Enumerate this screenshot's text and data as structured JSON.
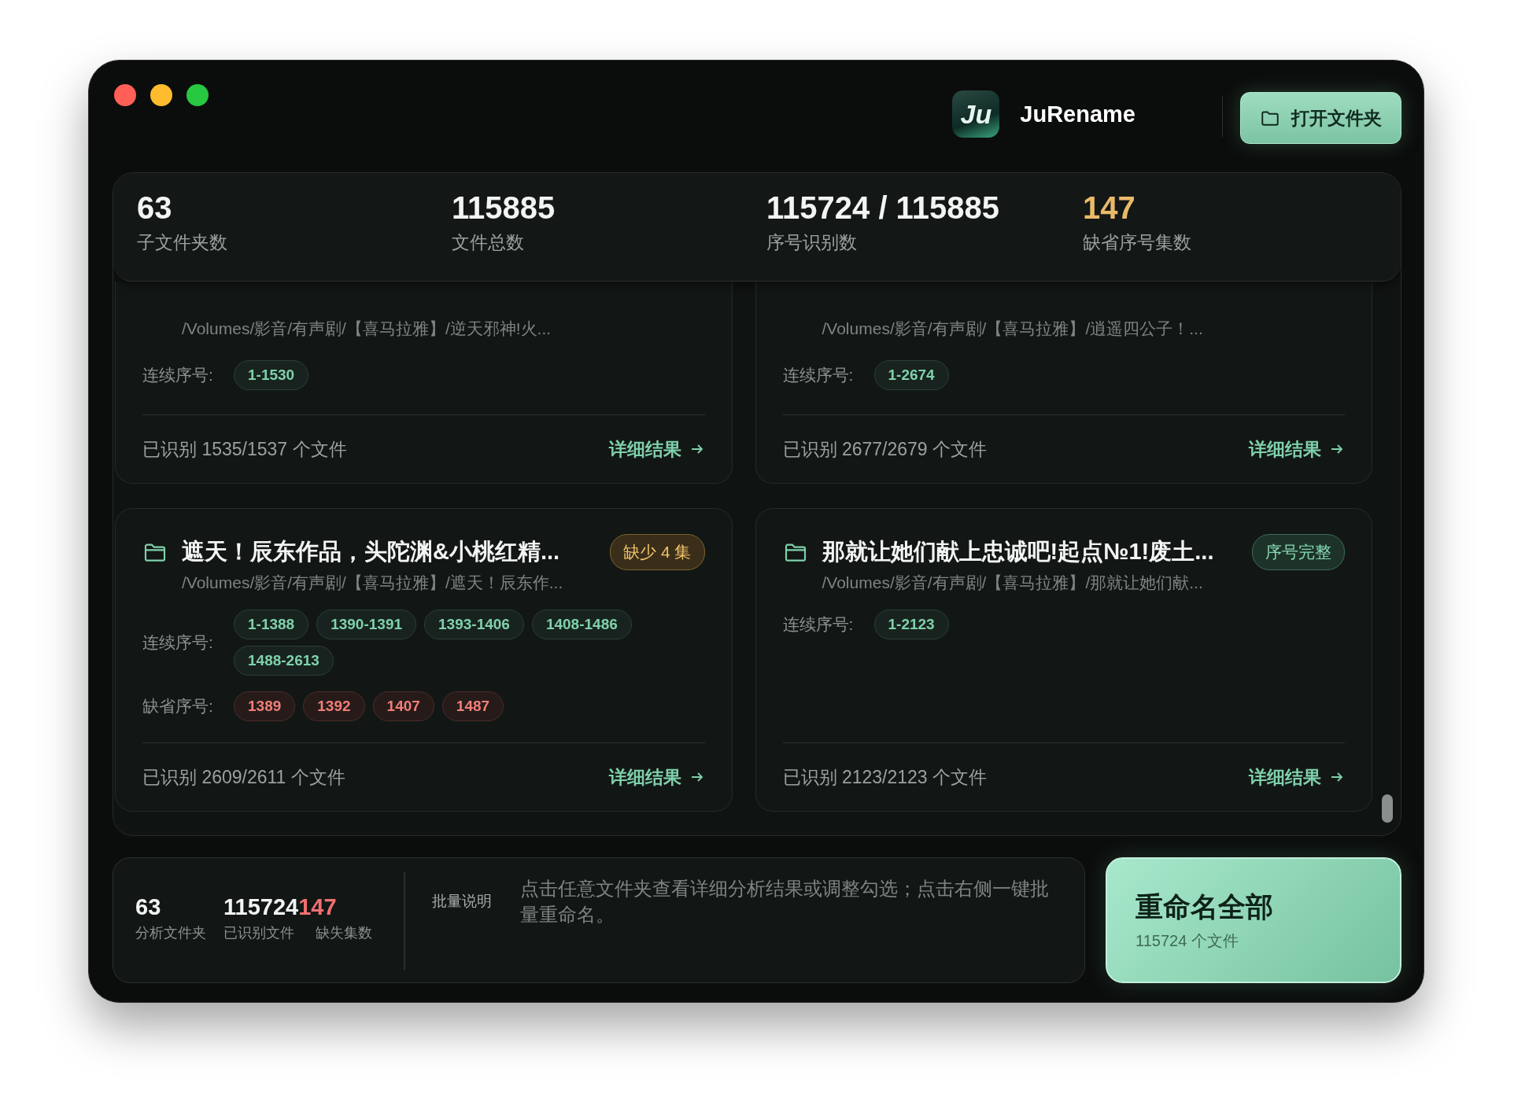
{
  "window": {
    "controls": [
      {
        "color": "#ff5f57"
      },
      {
        "color": "#febc2e"
      },
      {
        "color": "#28c840"
      }
    ]
  },
  "header": {
    "logo_text": "Ju",
    "app_name": "JuRename",
    "open_button": "打开文件夹"
  },
  "stats": [
    {
      "value": "63",
      "label": "子文件夹数",
      "kind": "normal"
    },
    {
      "value": "115885",
      "label": "文件总数",
      "kind": "normal"
    },
    {
      "value": "115724 / 115885",
      "label": "序号识别数",
      "kind": "normal"
    },
    {
      "value": "147",
      "label": "缺省序号集数",
      "kind": "warn"
    }
  ],
  "folders": [
    {
      "path": "/Volumes/影音/有声剧/【喜马拉雅】/逆天邪神!火...",
      "runs_label": "连续序号:",
      "runs": [
        "1-1530"
      ],
      "recognized": "已识别 1535/1537 个文件",
      "detail_link": "详细结果"
    },
    {
      "path": "/Volumes/影音/有声剧/【喜马拉雅】/逍遥四公子！...",
      "runs_label": "连续序号:",
      "runs": [
        "1-2674"
      ],
      "recognized": "已识别 2677/2679 个文件",
      "detail_link": "详细结果"
    },
    {
      "title": "遮天！辰东作品，头陀渊&小桃红精...",
      "badge": {
        "text": "缺少 4 集",
        "kind": "warn"
      },
      "path": "/Volumes/影音/有声剧/【喜马拉雅】/遮天！辰东作...",
      "runs_label": "连续序号:",
      "runs": [
        "1-1388",
        "1390-1391",
        "1393-1406",
        "1408-1486",
        "1488-2613"
      ],
      "missing_label": "缺省序号:",
      "missing": [
        "1389",
        "1392",
        "1407",
        "1487"
      ],
      "recognized": "已识别 2609/2611 个文件",
      "detail_link": "详细结果"
    },
    {
      "title": "那就让她们献上忠诚吧!起点№1!废土...",
      "badge": {
        "text": "序号完整",
        "kind": "ok"
      },
      "path": "/Volumes/影音/有声剧/【喜马拉雅】/那就让她们献...",
      "runs_label": "连续序号:",
      "runs": [
        "1-2123"
      ],
      "recognized": "已识别 2123/2123 个文件",
      "detail_link": "详细结果"
    }
  ],
  "summary": {
    "items": [
      {
        "value": "63",
        "label": "分析文件夹",
        "kind": "normal"
      },
      {
        "value": "115724",
        "label": "已识别文件",
        "kind": "normal"
      },
      {
        "value": "147",
        "label": "缺失集数",
        "kind": "missing"
      }
    ],
    "note_label": "批量说明",
    "note": "点击任意文件夹查看详细分析结果或调整勾选；点击右侧一键批量重命名。"
  },
  "rename": {
    "title": "重命名全部",
    "subtitle": "115724 个文件"
  }
}
